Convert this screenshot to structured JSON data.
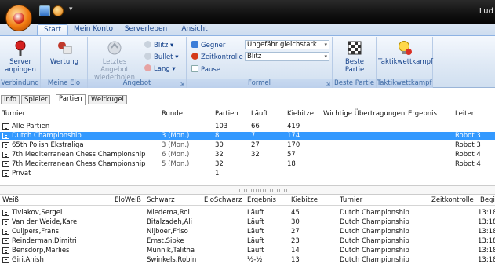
{
  "app": {
    "title": "Lud"
  },
  "ribbon": {
    "tabs": [
      "Start",
      "Mein Konto",
      "Serverleben",
      "Ansicht"
    ],
    "groups": {
      "verbindung": {
        "label": "Verbindung",
        "server": [
          "Server",
          "anpingen"
        ]
      },
      "meine_elo": {
        "label": "Meine Elo",
        "wertung": "Wertung"
      },
      "angebot": {
        "label": "Angebot",
        "letztes": [
          "Letztes Angebot",
          "wiederholen"
        ],
        "blitz": "Blitz",
        "bullet": "Bullet",
        "lang": "Lang"
      },
      "formel": {
        "label": "Formel",
        "gegner": "Gegner",
        "gegner_value": "Ungefähr gleichstark",
        "zeitkontrolle": "Zeitkontrolle",
        "zeit_value": "Blitz",
        "pause": "Pause"
      },
      "beste_partie": {
        "label": "Beste Partie",
        "btn": [
          "Beste",
          "Partie"
        ]
      },
      "taktik": {
        "label": "Taktikwettkampf",
        "btn": "Taktikwettkampf"
      }
    }
  },
  "doc_tabs": [
    "Info",
    "Spieler",
    "Partien",
    "Weltkugel"
  ],
  "tournaments": {
    "columns": [
      "Turnier",
      "Runde",
      "Partien",
      "Läuft",
      "Kiebitze",
      "Wichtige Übertragungen",
      "Ergebnis",
      "Leiter"
    ],
    "rows": [
      {
        "name": "Alle Partien",
        "runde": "",
        "partien": "103",
        "laeuft": "66",
        "kiebitze": "419",
        "leiter": ""
      },
      {
        "name": "Dutch Championship",
        "runde": "3 (Mon.)",
        "partien": "8",
        "laeuft": "7",
        "kiebitze": "174",
        "leiter": "Robot 3"
      },
      {
        "name": "65th Polish Ekstraliga",
        "runde": "3 (Mon.)",
        "partien": "30",
        "laeuft": "27",
        "kiebitze": "170",
        "leiter": "Robot 3"
      },
      {
        "name": "7th Mediterranean Chess Championship",
        "runde": "6 (Mon.)",
        "partien": "32",
        "laeuft": "32",
        "kiebitze": "57",
        "leiter": "Robot 4"
      },
      {
        "name": "7th Mediterranean Chess Championship",
        "runde": "5 (Mon.)",
        "partien": "32",
        "laeuft": "",
        "kiebitze": "18",
        "leiter": "Robot 4"
      },
      {
        "name": "Privat",
        "runde": "",
        "partien": "1",
        "laeuft": "",
        "kiebitze": "",
        "leiter": ""
      }
    ]
  },
  "games": {
    "columns": [
      "Weiß",
      "EloWeiß",
      "Schwarz",
      "EloSchwarz",
      "Ergebnis",
      "Kiebitze",
      "Turnier",
      "Zeitkontrolle",
      "Begi"
    ],
    "rows": [
      {
        "white": "Tiviakov,Sergei",
        "black": "Miedema,Roi",
        "result": "Läuft",
        "kiebitze": "45",
        "turnier": "Dutch Championship",
        "begin": "13:18"
      },
      {
        "white": "Van der Weide,Karel",
        "black": "Bitalzadeh,Ali",
        "result": "Läuft",
        "kiebitze": "30",
        "turnier": "Dutch Championship",
        "begin": "13:18"
      },
      {
        "white": "Cuijpers,Frans",
        "black": "Nijboer,Friso",
        "result": "Läuft",
        "kiebitze": "27",
        "turnier": "Dutch Championship",
        "begin": "13:18"
      },
      {
        "white": "Reinderman,Dimitri",
        "black": "Ernst,Sipke",
        "result": "Läuft",
        "kiebitze": "23",
        "turnier": "Dutch Championship",
        "begin": "13:18"
      },
      {
        "white": "Bensdorp,Marlies",
        "black": "Munnik,Talitha",
        "result": "Läuft",
        "kiebitze": "14",
        "turnier": "Dutch Championship",
        "begin": "13:18"
      },
      {
        "white": "Giri,Anish",
        "black": "Swinkels,Robin",
        "result": "½-½",
        "kiebitze": "13",
        "turnier": "Dutch Championship",
        "begin": "13:18"
      }
    ]
  },
  "colors": {
    "selection": "#3399ff",
    "ribbon_text": "#15428b",
    "group_label": "#3e6aa4",
    "titlebar": "#111111"
  }
}
